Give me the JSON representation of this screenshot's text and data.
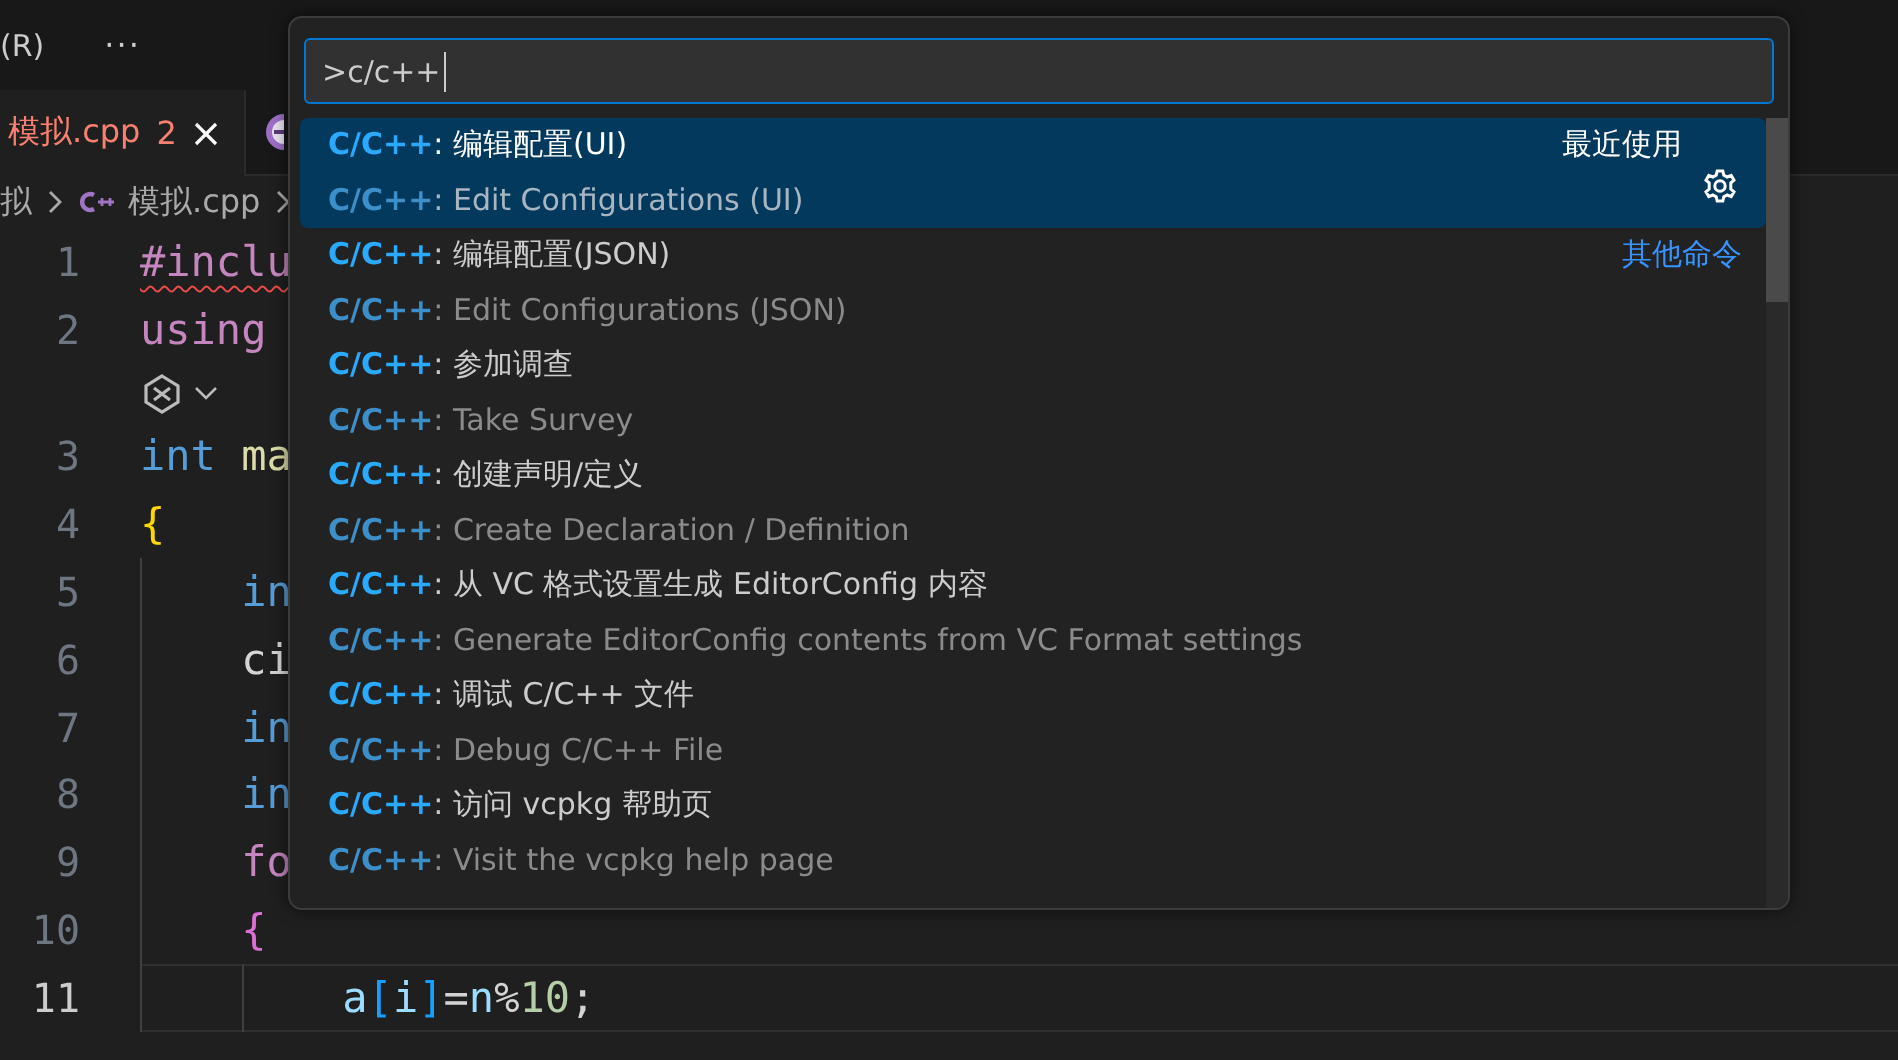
{
  "menu": {
    "label": "(R)",
    "more": "···"
  },
  "tabs": [
    {
      "label": "模拟.cpp",
      "problems": "2",
      "error": true,
      "selected": true
    },
    {
      "selected": false,
      "error": false
    }
  ],
  "breadcrumb": [
    "拟",
    "模拟.cpp"
  ],
  "editor": {
    "lines": [
      {
        "kind": "code",
        "number": "1",
        "current": false,
        "tokens": [
          {
            "text": "#inclu",
            "kind": "directive",
            "error": true
          }
        ]
      },
      {
        "kind": "code",
        "number": "2",
        "current": false,
        "tokens": [
          {
            "text": "using",
            "kind": "keyword",
            "error": false
          }
        ]
      },
      {
        "kind": "codelens"
      },
      {
        "kind": "code",
        "number": "3",
        "current": false,
        "tokens": [
          {
            "text": "int",
            "kind": "type",
            "error": false
          },
          {
            "text": " ma",
            "kind": "function",
            "error": false
          }
        ]
      },
      {
        "kind": "code",
        "number": "4",
        "current": false,
        "tokens": [
          {
            "text": "{",
            "kind": "bracket1",
            "error": false
          }
        ]
      },
      {
        "kind": "code",
        "number": "5",
        "current": false,
        "tokens": [
          {
            "text": "    in",
            "kind": "type",
            "error": false
          }
        ]
      },
      {
        "kind": "code",
        "number": "6",
        "current": false,
        "tokens": [
          {
            "text": "    ci",
            "kind": "plain",
            "error": false
          }
        ]
      },
      {
        "kind": "code",
        "number": "7",
        "current": false,
        "tokens": [
          {
            "text": "    in",
            "kind": "type",
            "error": false
          }
        ]
      },
      {
        "kind": "code",
        "number": "8",
        "current": false,
        "tokens": [
          {
            "text": "    in",
            "kind": "type",
            "error": false
          }
        ]
      },
      {
        "kind": "code",
        "number": "9",
        "current": false,
        "tokens": [
          {
            "text": "    fo",
            "kind": "keyword",
            "error": false
          }
        ]
      },
      {
        "kind": "code",
        "number": "10",
        "current": false,
        "tokens": [
          {
            "text": "    {",
            "kind": "bracket2",
            "error": false
          }
        ]
      },
      {
        "kind": "code",
        "number": "11",
        "current": true,
        "tokens": [
          {
            "text": "        a",
            "kind": "variable",
            "error": false
          },
          {
            "text": "[",
            "kind": "bracket3",
            "error": false
          },
          {
            "text": "i",
            "kind": "variable",
            "error": false
          },
          {
            "text": "]",
            "kind": "bracket3",
            "error": false
          },
          {
            "text": "=",
            "kind": "plain",
            "error": false
          },
          {
            "text": "n",
            "kind": "variable",
            "error": false
          },
          {
            "text": "%",
            "kind": "plain",
            "error": false
          },
          {
            "text": "10",
            "kind": "number",
            "error": false
          },
          {
            "text": ";",
            "kind": "plain",
            "error": false
          }
        ]
      }
    ]
  },
  "palette": {
    "input": {
      "value": ">c/c++"
    },
    "items": [
      {
        "label": "**C/C++**: 编辑配置(UI)",
        "detail": "**C/C++**: Edit Configurations (UI)",
        "selected": true,
        "hint": {
          "text": "最近使用",
          "kind": "label"
        },
        "gear": true
      },
      {
        "label": "**C/C++**: 编辑配置(JSON)",
        "detail": "**C/C++**: Edit Configurations (JSON)",
        "selected": false,
        "hint": {
          "text": "其他命令",
          "kind": "link"
        }
      },
      {
        "label": "**C/C++**: 参加调查",
        "detail": "**C/C++**: Take Survey",
        "selected": false
      },
      {
        "label": "**C/C++**: 创建声明/定义",
        "detail": "**C/C++**: Create Declaration / Definition",
        "selected": false
      },
      {
        "label": "**C/C++**: 从 VC 格式设置生成 EditorConfig 内容",
        "detail": "**C/C++**: Generate EditorConfig contents from VC Format settings",
        "selected": false
      },
      {
        "label": "**C/C++**: 调试 C/C++ 文件",
        "detail": "**C/C++**: Debug C/C++ File",
        "selected": false
      },
      {
        "label": "**C/C++**: 访问 vcpkg 帮助页",
        "detail": "**C/C++**: Visit the vcpkg help page",
        "selected": false
      }
    ]
  }
}
